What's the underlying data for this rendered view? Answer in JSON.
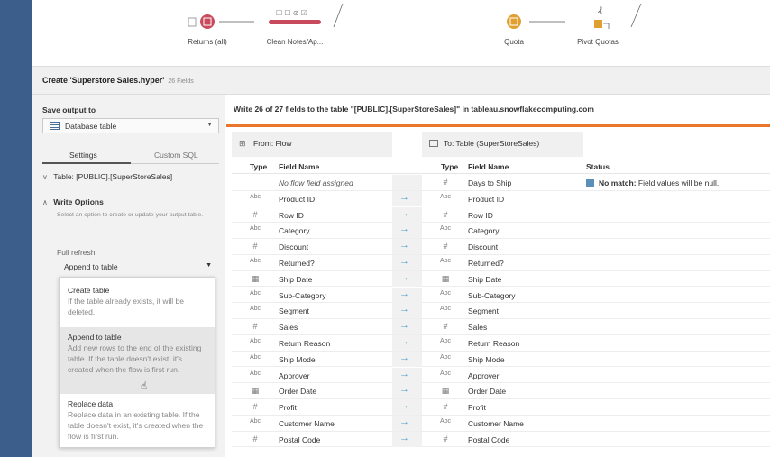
{
  "flow_nodes": [
    {
      "label": "Returns (all)"
    },
    {
      "label": "Clean Notes/Ap..."
    },
    {
      "label": "Quota"
    },
    {
      "label": "Pivot Quotas"
    }
  ],
  "title": {
    "text": "Create 'Superstore Sales.hyper'",
    "count": "26 Fields"
  },
  "panel": {
    "save_output_label": "Save output to",
    "save_output_value": "Database table",
    "tab_settings": "Settings",
    "tab_custom_sql": "Custom SQL",
    "table_label": "Table: [PUBLIC].[SuperStoreSales]",
    "write_options_label": "Write Options",
    "write_options_desc": "Select an option to create or update your output table.",
    "full_refresh_label": "Full refresh",
    "append_value": "Append to table"
  },
  "menu": {
    "options": [
      {
        "title": "Create table",
        "desc": "If the table already exists, it will be deleted."
      },
      {
        "title": "Append to table",
        "desc": "Add new rows to the end of the existing table. If the table doesn't exist, it's created when the flow is first run."
      },
      {
        "title": "Replace data",
        "desc": "Replace data in an existing table. If the table doesn't exist, it's created when the flow is first run."
      }
    ]
  },
  "main": {
    "write_title": "Write 26 of 27 fields to the table \"[PUBLIC].[SuperStoreSales]\" in tableau.snowflakecomputing.com",
    "from_label": "From: Flow",
    "to_label": "To: Table (SuperStoreSales)",
    "col_type": "Type",
    "col_field": "Field Name",
    "col_status": "Status",
    "no_match_bold": "No match:",
    "no_match_text": "Field values will be null.",
    "rows": [
      {
        "from_type": "",
        "from_name": "No flow field assigned",
        "to_type": "#",
        "to_name": "Days to Ship",
        "status": true
      },
      {
        "from_type": "Abc",
        "from_name": "Product ID",
        "to_type": "Abc",
        "to_name": "Product ID"
      },
      {
        "from_type": "#",
        "from_name": "Row ID",
        "to_type": "#",
        "to_name": "Row ID"
      },
      {
        "from_type": "Abc",
        "from_name": "Category",
        "to_type": "Abc",
        "to_name": "Category"
      },
      {
        "from_type": "#",
        "from_name": "Discount",
        "to_type": "#",
        "to_name": "Discount"
      },
      {
        "from_type": "Abc",
        "from_name": "Returned?",
        "to_type": "Abc",
        "to_name": "Returned?"
      },
      {
        "from_type": "date",
        "from_name": "Ship Date",
        "to_type": "date",
        "to_name": "Ship Date"
      },
      {
        "from_type": "Abc",
        "from_name": "Sub-Category",
        "to_type": "Abc",
        "to_name": "Sub-Category"
      },
      {
        "from_type": "Abc",
        "from_name": "Segment",
        "to_type": "Abc",
        "to_name": "Segment"
      },
      {
        "from_type": "#",
        "from_name": "Sales",
        "to_type": "#",
        "to_name": "Sales"
      },
      {
        "from_type": "Abc",
        "from_name": "Return Reason",
        "to_type": "Abc",
        "to_name": "Return Reason"
      },
      {
        "from_type": "Abc",
        "from_name": "Ship Mode",
        "to_type": "Abc",
        "to_name": "Ship Mode"
      },
      {
        "from_type": "Abc",
        "from_name": "Approver",
        "to_type": "Abc",
        "to_name": "Approver"
      },
      {
        "from_type": "date",
        "from_name": "Order Date",
        "to_type": "date",
        "to_name": "Order Date"
      },
      {
        "from_type": "#",
        "from_name": "Profit",
        "to_type": "#",
        "to_name": "Profit"
      },
      {
        "from_type": "Abc",
        "from_name": "Customer Name",
        "to_type": "Abc",
        "to_name": "Customer Name"
      },
      {
        "from_type": "#",
        "from_name": "Postal Code",
        "to_type": "#",
        "to_name": "Postal Code"
      }
    ]
  },
  "colors": {
    "accent": "#e8762d",
    "sidebar": "#3b5f8a",
    "node_red": "#c94a5c",
    "node_orange": "#e0a030",
    "arrow": "#4a9fd0"
  }
}
